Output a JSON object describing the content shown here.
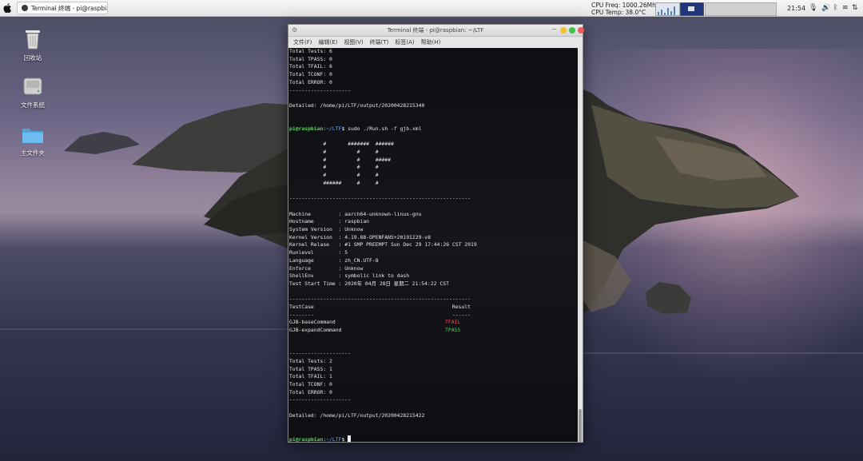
{
  "menubar": {
    "task_title": "Terminal 终端 - pi@raspbia···",
    "cpu_freq": "CPU Freq: 1000.26Mhz",
    "cpu_temp": "CPU Temp: 38.0°C",
    "clock": "21:54",
    "tray_icons": [
      "mic-icon",
      "volume-icon",
      "bluetooth-icon",
      "wifi-icon",
      "network-icon"
    ]
  },
  "desktop": {
    "icons": [
      {
        "label": "回收站",
        "icon": "trash-icon"
      },
      {
        "label": "文件系统",
        "icon": "drive-icon"
      },
      {
        "label": "主文件夹",
        "icon": "folder-icon"
      }
    ]
  },
  "window": {
    "title": "Terminal 终端 - pi@raspbian: ~/LTF",
    "menu": [
      "文件(F)",
      "编辑(E)",
      "视图(V)",
      "终端(T)",
      "标签(A)",
      "帮助(H)"
    ],
    "controls_colors": {
      "yellow": "#f5c032",
      "green": "#3cc44a",
      "red": "#ee5b52"
    }
  },
  "terminal": {
    "lines": [
      "Total Tests: 6",
      "Total TPASS: 0",
      "Total TFAIL: 6",
      "Total TCONF: 0",
      "Total ERROR: 0",
      "--------------------",
      "",
      "Detailed: /home/pi/LTF/output/20200428215340",
      "",
      "",
      "",
      "           #       #######  ######",
      "           #          #     #",
      "           #          #     #####",
      "           #          #     #",
      "           #          #     #",
      "           ######     #     #",
      "",
      "-----------------------------------------------------------",
      "",
      "Machine         : aarch64-unknown-linux-gnu",
      "Hostname        : raspbian",
      "System Version  : Unknow",
      "Kernel Version  : 4.19.88-OPENFANS+20191229-v8",
      "Kernel Relase   : #1 SMP PREEMPT Sun Dec 29 17:44:26 CST 2019",
      "Runlevel        : 5",
      "Language        : zh_CN.UTF-8",
      "Enforce         : Unknow",
      "ShellEnv        : symbolic link to dash",
      "Test Start Time : 2020年 04月 28日 星期二 21:54:22 CST",
      "",
      "-----------------------------------------------------------",
      "TestCase                                             Result",
      "--------                                             ------",
      "",
      "",
      "",
      "",
      "",
      "--------------------",
      "Total Tests: 2",
      "Total TPASS: 1",
      "Total TFAIL: 1",
      "Total TCONF: 0",
      "Total ERROR: 0",
      "--------------------",
      "",
      "Detailed: /home/pi/LTF/output/20200428215422",
      "",
      ""
    ],
    "prompt_user": "pi@raspbian",
    "prompt_sep": ":",
    "prompt_path": "~/LTF",
    "prompt_end": "$",
    "command": " sudo ./Run.sh -f gjb.xml",
    "results": [
      {
        "testcase": "GJB-baseCommand",
        "result": "TFAIL"
      },
      {
        "testcase": "GJB-expandCommand",
        "result": "TPASS"
      }
    ]
  }
}
